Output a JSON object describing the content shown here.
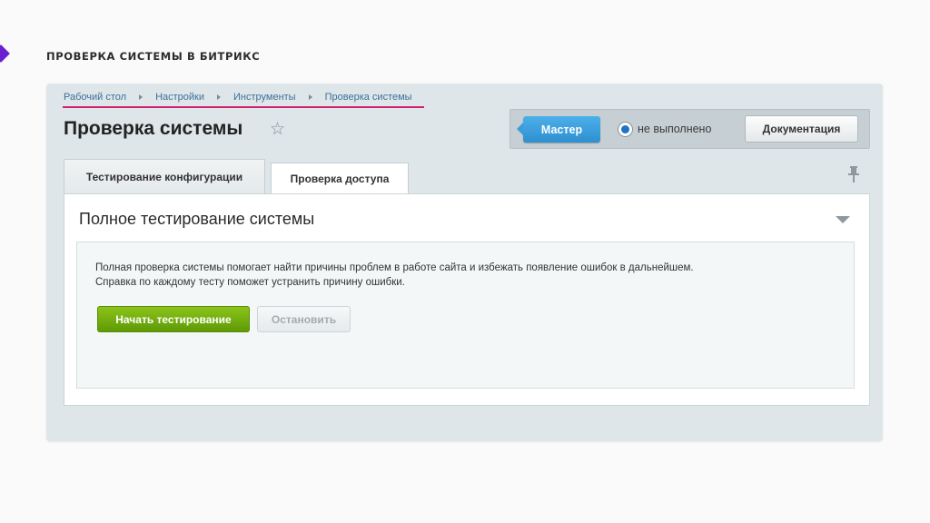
{
  "slide": {
    "title": "ПРОВЕРКА СИСТЕМЫ В БИТРИКС",
    "accent_color": "#6a1fd0"
  },
  "breadcrumb": {
    "items": [
      "Рабочий стол",
      "Настройки",
      "Инструменты",
      "Проверка системы"
    ],
    "highlight_color": "#d0216f"
  },
  "header": {
    "title": "Проверка системы",
    "favorite_icon": "star-outline-icon"
  },
  "toolbar": {
    "master_label": "Мастер",
    "status_label": "не выполнено",
    "docs_label": "Документация"
  },
  "tabs": [
    {
      "label": "Тестирование конфигурации",
      "active": true
    },
    {
      "label": "Проверка доступа",
      "active": false
    }
  ],
  "section": {
    "title": "Полное тестирование системы",
    "description_line1": "Полная проверка системы помогает найти причины проблем в работе сайта и избежать появление ошибок в дальнейшем.",
    "description_line2": "Справка по каждому тесту поможет устранить причину ошибки.",
    "start_label": "Начать тестирование",
    "stop_label": "Остановить",
    "start_color": "#72ab0f"
  }
}
